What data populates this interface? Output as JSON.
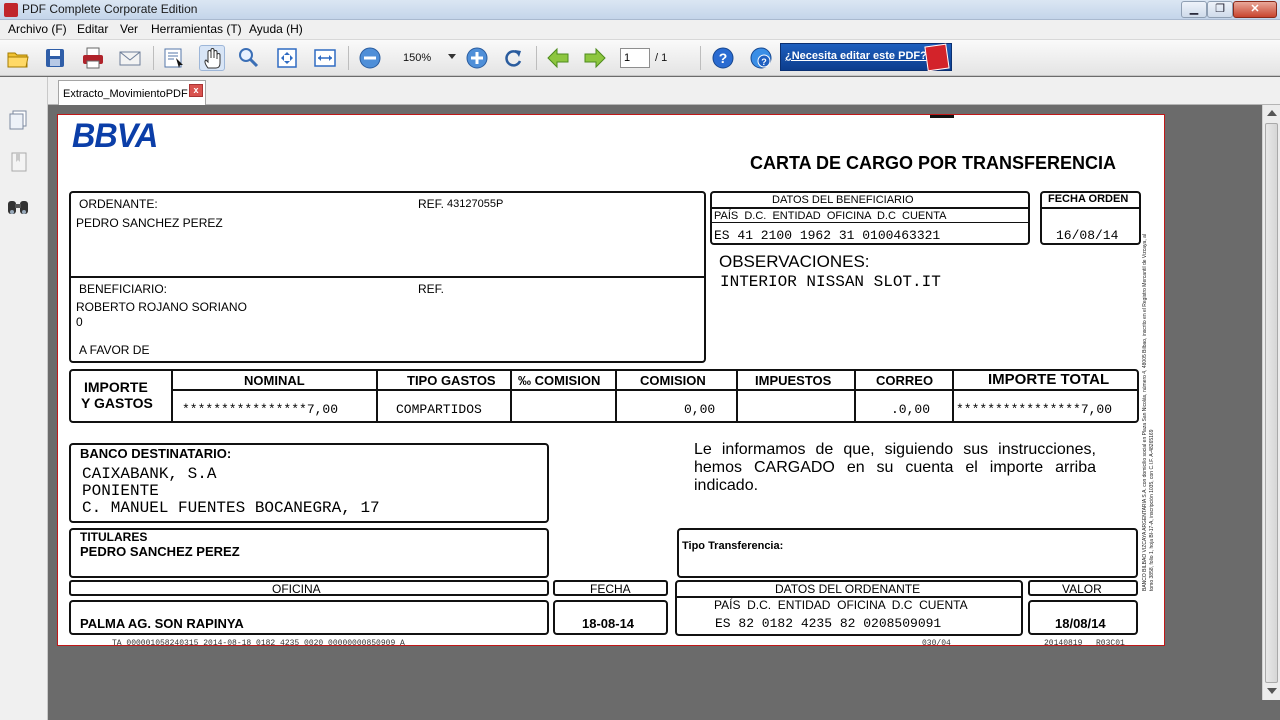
{
  "window": {
    "title": "PDF Complete Corporate Edition",
    "minimize": "▁",
    "maximize": "❐",
    "close": "✕"
  },
  "menu": [
    "Archivo (F)",
    "Editar",
    "Ver",
    "Herramientas (T)",
    "Ayuda (H)"
  ],
  "toolbar": {
    "zoom": "150%",
    "page_current": "1",
    "page_total": "/ 1",
    "ad_text": "¿Necesita editar este PDF?"
  },
  "tab": {
    "label": "Extracto_MovimientoPDF",
    "close": "x"
  },
  "document": {
    "logo": "BBVA",
    "heading": "CARTA DE CARGO POR TRANSFERENCIA",
    "ordenante_label": "ORDENANTE:",
    "ordenante_ref_label": "REF.",
    "ordenante_ref": "43127055P",
    "ordenante_name": "PEDRO SANCHEZ PEREZ",
    "beneficiario_label": "BENEFICIARIO:",
    "beneficiario_ref_label": "REF.",
    "beneficiario_name": "ROBERTO ROJANO SORIANO",
    "beneficiario_line2": "0",
    "a_favor_de": "A FAVOR DE",
    "datos_beneficiario": {
      "title": "DATOS DEL BENEFICIARIO",
      "headers": "PAÍS  D.C.  ENTIDAD  OFICINA  D.C  CUENTA",
      "value": "ES 41 2100 1962 31 0100463321"
    },
    "fecha_orden": {
      "label": "FECHA ORDEN",
      "value": "16/08/14"
    },
    "observaciones": {
      "label": "OBSERVACIONES:",
      "value": "INTERIOR NISSAN SLOT.IT"
    },
    "importe": {
      "side_label_1": "IMPORTE",
      "side_label_2": "Y GASTOS",
      "headers": [
        "NOMINAL",
        "TIPO GASTOS",
        "‰ COMISION",
        "COMISION",
        "IMPUESTOS",
        "CORREO",
        "IMPORTE TOTAL"
      ],
      "values": [
        "****************7,00",
        "COMPARTIDOS",
        "",
        "0,00",
        "",
        ".0,00",
        "****************7,00"
      ]
    },
    "banco": {
      "label": "BANCO DESTINATARIO:",
      "line1": "CAIXABANK, S.A",
      "line2": "PONIENTE",
      "line3": "C. MANUEL FUENTES BOCANEGRA, 17"
    },
    "informamos": "Le informamos de que, siguiendo sus instrucciones, hemos CARGADO en su cuenta el importe arriba indicado.",
    "titulares": {
      "label": "TITULARES",
      "value": "PEDRO SANCHEZ PEREZ"
    },
    "tipo_transferencia_label": "Tipo Transferencia:",
    "oficina": {
      "label": "OFICINA",
      "value": "PALMA AG. SON RAPINYA"
    },
    "fecha": {
      "label": "FECHA",
      "value": "18-08-14"
    },
    "datos_ordenante": {
      "title": "DATOS DEL ORDENANTE",
      "headers": "PAÍS  D.C.  ENTIDAD  OFICINA  D.C  CUENTA",
      "value": "ES 82 0182 4235 82 0208509091"
    },
    "valor": {
      "label": "VALOR",
      "value": "18/08/14"
    },
    "footer_code": "TA 000001058240315 2014-08-18 0182 4235 0020 00000000850909 A",
    "footer_page": "030/04",
    "footer_date": "20140819",
    "footer_form": "R03C01",
    "side_legal": "BANCO BILBAO VIZCAYA ARGENTARIA S.A. con domicilio social en Plaza San Nicolás, número 4, 48005 Bilbao, inscrito en el Registro Mercantil de Vizcaya, al tomo 3858, folio 1, hoja BI-17-A, inscripción 1035, con C.I.F. A-48265169"
  }
}
